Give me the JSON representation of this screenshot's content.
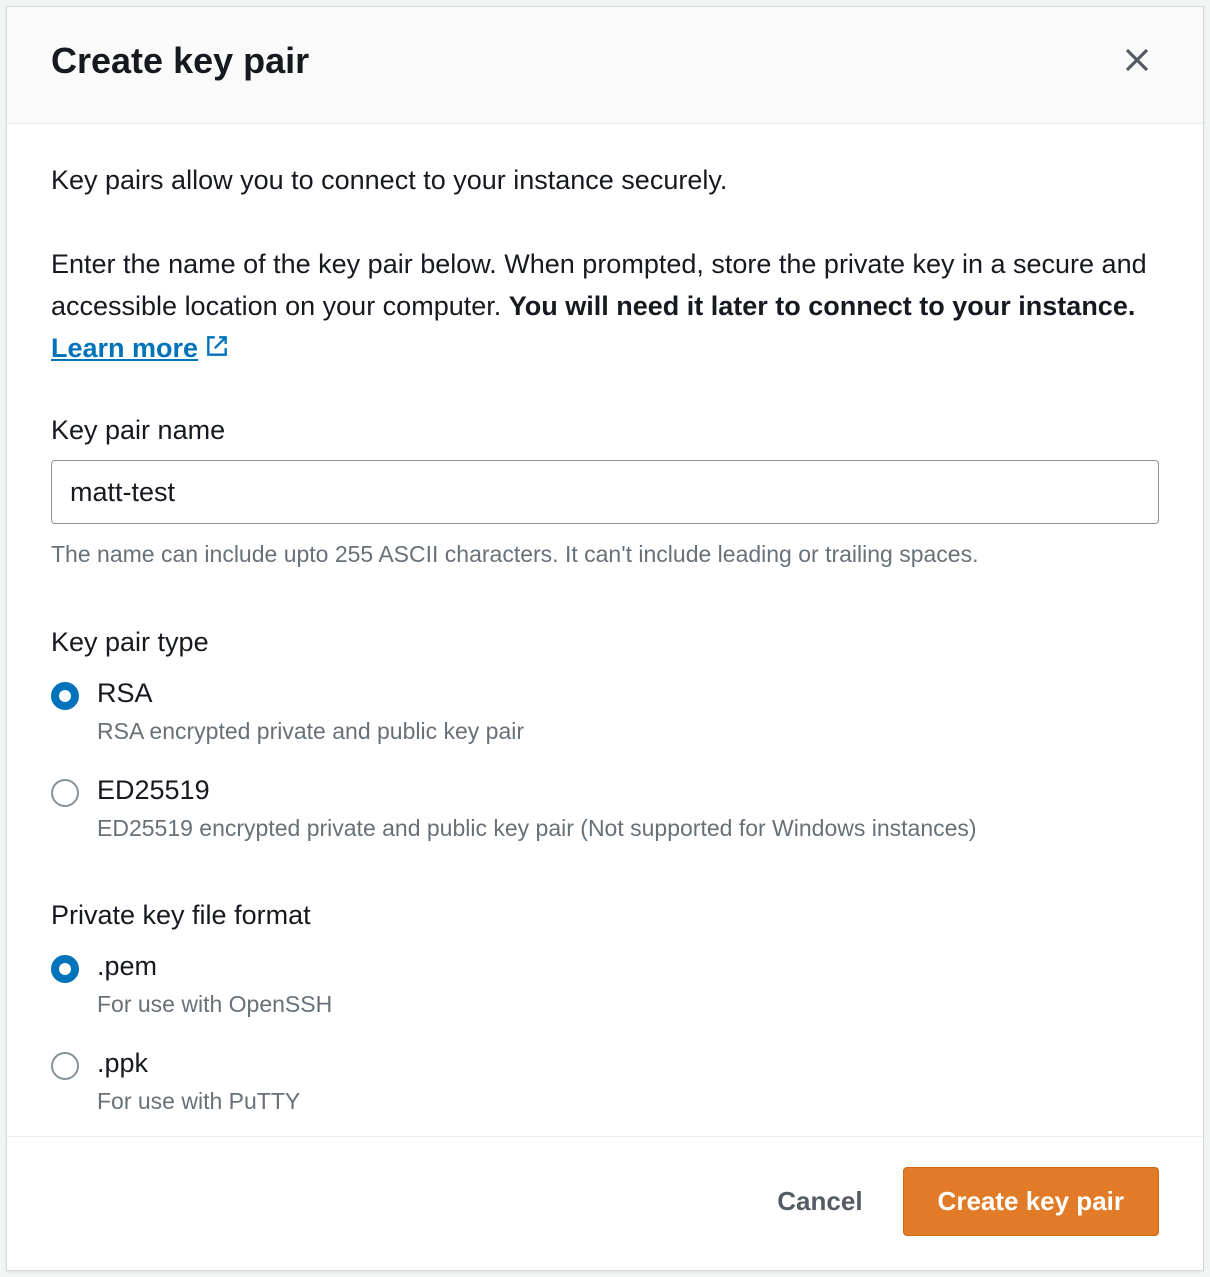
{
  "header": {
    "title": "Create key pair"
  },
  "body": {
    "intro1": "Key pairs allow you to connect to your instance securely.",
    "intro2_pre": "Enter the name of the key pair below. When prompted, store the private key in a secure and accessible location on your computer. ",
    "intro2_bold": "You will need it later to connect to your instance. ",
    "learn_more_label": "Learn more",
    "name_field": {
      "label": "Key pair name",
      "value": "matt-test",
      "hint": "The name can include upto 255 ASCII characters. It can't include leading or trailing spaces."
    },
    "type_section": {
      "title": "Key pair type",
      "options": [
        {
          "title": "RSA",
          "desc": "RSA encrypted private and public key pair",
          "selected": true
        },
        {
          "title": "ED25519",
          "desc": "ED25519 encrypted private and public key pair (Not supported for Windows instances)",
          "selected": false
        }
      ]
    },
    "format_section": {
      "title": "Private key file format",
      "options": [
        {
          "title": ".pem",
          "desc": "For use with OpenSSH",
          "selected": true
        },
        {
          "title": ".ppk",
          "desc": "For use with PuTTY",
          "selected": false
        }
      ]
    }
  },
  "footer": {
    "cancel_label": "Cancel",
    "submit_label": "Create key pair"
  }
}
